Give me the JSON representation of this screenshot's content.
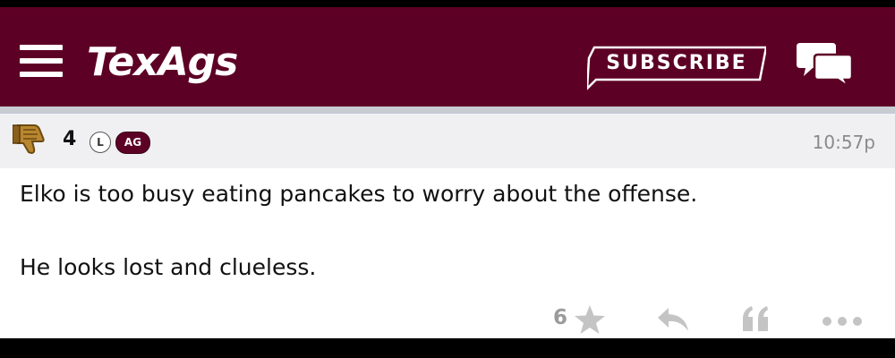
{
  "header": {
    "logo_text": "TexAgs",
    "subscribe_label": "SUBSCRIBE",
    "menu_icon": "hamburger-menu-icon",
    "chat_icon": "chat-bubbles-icon"
  },
  "post": {
    "rating_icon": "thumbs-down-icon",
    "rating": "4",
    "badge_l": "L",
    "badge_ag": "AG",
    "timestamp": "10:57p",
    "lines": [
      "Elko is too busy eating pancakes to worry about the offense.",
      "He looks lost and clueless."
    ],
    "actions": {
      "star_count": "6",
      "star_icon": "star-icon",
      "reply_icon": "reply-icon",
      "quote_icon": "quote-icon",
      "more_icon": "more-dots-icon"
    }
  },
  "colors": {
    "brand": "#5d0025",
    "meta_bg": "#f0f0f3",
    "icon_gray": "#9b9b9b"
  }
}
